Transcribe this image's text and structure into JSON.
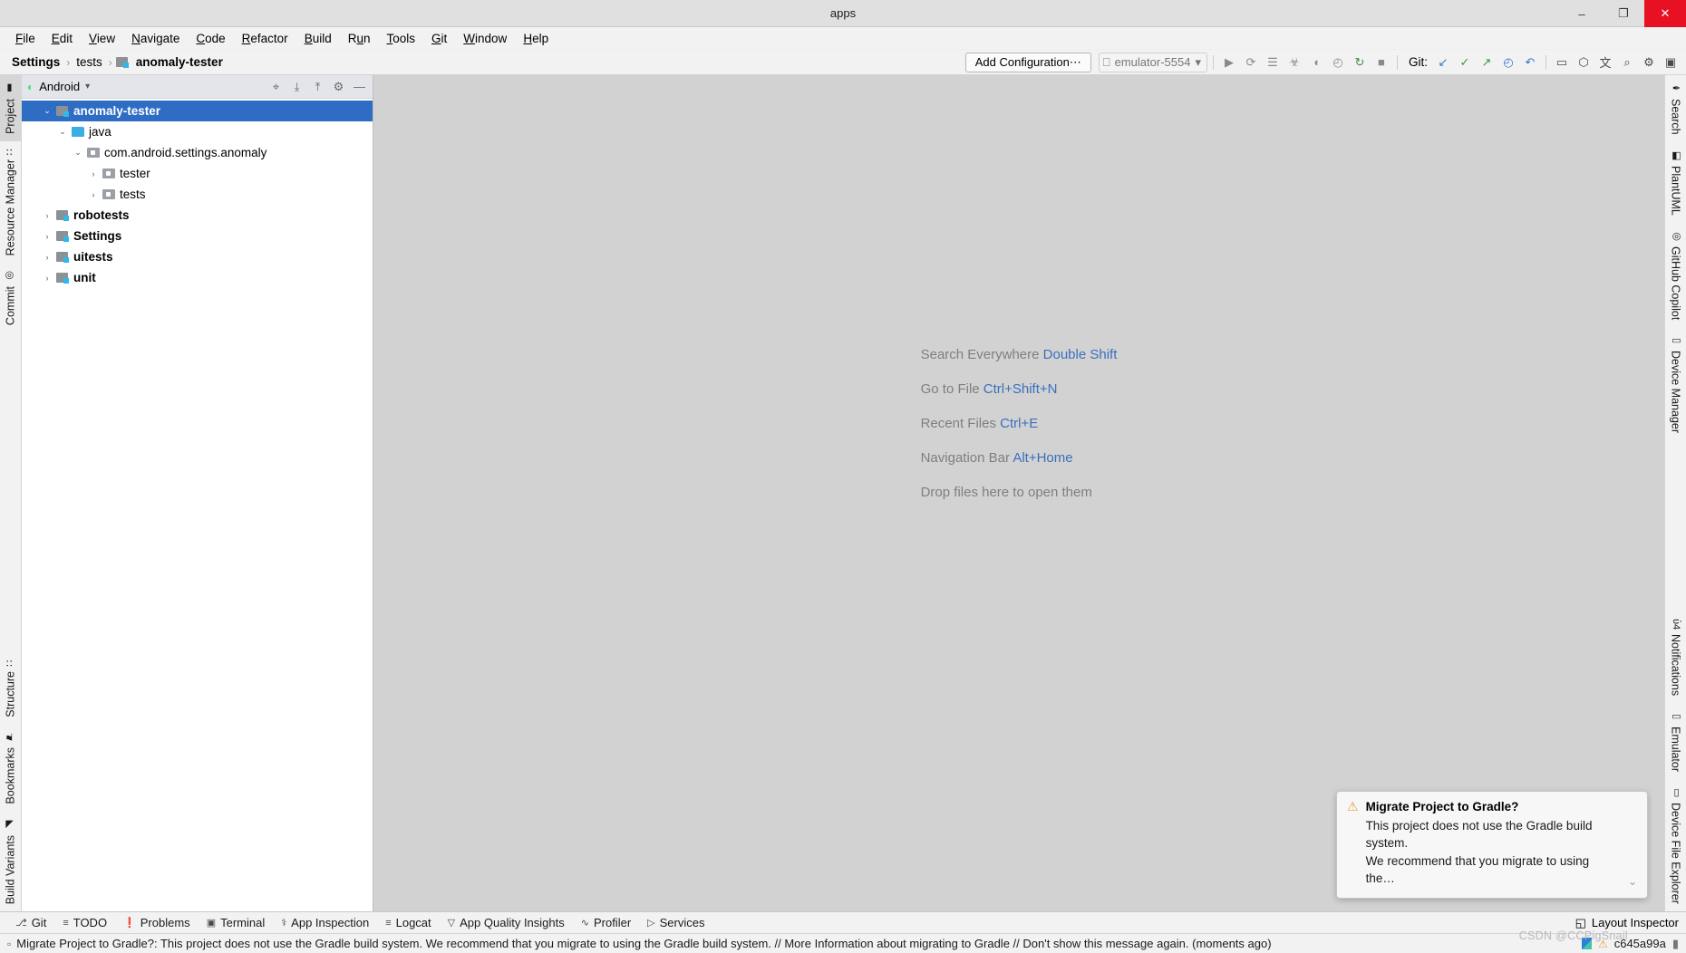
{
  "window": {
    "title": "apps",
    "minimize": "–",
    "maximize": "❐",
    "close": "✕"
  },
  "menubar": {
    "items": [
      {
        "pre": "",
        "mn": "F",
        "post": "ile"
      },
      {
        "pre": "",
        "mn": "E",
        "post": "dit"
      },
      {
        "pre": "",
        "mn": "V",
        "post": "iew"
      },
      {
        "pre": "",
        "mn": "N",
        "post": "avigate"
      },
      {
        "pre": "",
        "mn": "C",
        "post": "ode"
      },
      {
        "pre": "",
        "mn": "R",
        "post": "efactor"
      },
      {
        "pre": "",
        "mn": "B",
        "post": "uild"
      },
      {
        "pre": "R",
        "mn": "u",
        "post": "n"
      },
      {
        "pre": "",
        "mn": "T",
        "post": "ools"
      },
      {
        "pre": "",
        "mn": "G",
        "post": "it"
      },
      {
        "pre": "",
        "mn": "W",
        "post": "indow"
      },
      {
        "pre": "",
        "mn": "H",
        "post": "elp"
      }
    ]
  },
  "breadcrumb": {
    "items": [
      "Settings",
      "tests",
      "anomaly-tester"
    ],
    "separator": "›"
  },
  "toolbar": {
    "add_configuration": "Add Configuration⋯",
    "device": "emulator-5554",
    "device_caret": "▾",
    "git_label": "Git:",
    "icons": [
      {
        "name": "run-icon",
        "glyph": "▶"
      },
      {
        "name": "run-coverage-icon",
        "glyph": "⟳"
      },
      {
        "name": "logcat-icon",
        "glyph": "☰"
      },
      {
        "name": "debug-icon",
        "glyph": "☣"
      },
      {
        "name": "attach-debugger-icon",
        "glyph": "◖"
      },
      {
        "name": "profiler-icon",
        "glyph": "◴"
      },
      {
        "name": "sync-gradle-icon",
        "glyph": "↻"
      },
      {
        "name": "stop-icon",
        "glyph": "■"
      }
    ],
    "git_icons": [
      {
        "name": "update-project-icon",
        "glyph": "↙"
      },
      {
        "name": "commit-icon",
        "glyph": "✓"
      },
      {
        "name": "push-icon",
        "glyph": "↗"
      },
      {
        "name": "history-icon",
        "glyph": "◴"
      },
      {
        "name": "rollback-icon",
        "glyph": "↶"
      }
    ],
    "right_icons": [
      {
        "name": "avd-manager-icon",
        "glyph": "▭"
      },
      {
        "name": "sdk-manager-icon",
        "glyph": "⬡"
      },
      {
        "name": "translate-icon",
        "glyph": "文"
      },
      {
        "name": "search-icon",
        "glyph": "⌕"
      },
      {
        "name": "settings-gear-icon",
        "glyph": "⚙"
      },
      {
        "name": "account-icon",
        "glyph": "▣"
      }
    ]
  },
  "left_sidebar": {
    "top": [
      {
        "label": "Project",
        "icon": "project-folder-icon",
        "glyph": "▮",
        "active": true
      },
      {
        "label": "Resource Manager",
        "icon": "resource-manager-icon",
        "glyph": "∷",
        "active": false
      },
      {
        "label": "Commit",
        "icon": "commit-icon",
        "glyph": "◎",
        "active": false
      }
    ],
    "bottom": [
      {
        "label": "Structure",
        "icon": "structure-icon",
        "glyph": "∷",
        "active": false
      },
      {
        "label": "Bookmarks",
        "icon": "bookmark-icon",
        "glyph": "⚑",
        "active": false
      },
      {
        "label": "Build Variants",
        "icon": "build-variants-icon",
        "glyph": "◢",
        "active": false
      }
    ]
  },
  "right_sidebar": {
    "top": [
      {
        "label": "Search",
        "icon": "search-feather-icon",
        "glyph": "✒"
      },
      {
        "label": "PlantUML",
        "icon": "plantuml-icon",
        "glyph": "◧"
      },
      {
        "label": "GitHub Copilot",
        "icon": "github-copilot-icon",
        "glyph": "◎"
      },
      {
        "label": "Device Manager",
        "icon": "device-manager-icon",
        "glyph": "▭"
      }
    ],
    "bottom": [
      {
        "label": "Notifications",
        "icon": "notifications-bell-icon",
        "glyph": "ὑ4"
      },
      {
        "label": "Emulator",
        "icon": "emulator-icon",
        "glyph": "▭"
      },
      {
        "label": "Device File Explorer",
        "icon": "device-file-explorer-icon",
        "glyph": "▯"
      }
    ]
  },
  "project_panel": {
    "header": {
      "title": "Android",
      "android_icon": "android-robot-icon",
      "caret": "▾",
      "actions": [
        {
          "name": "select-opened-file-icon",
          "glyph": "⌖"
        },
        {
          "name": "expand-all-icon",
          "glyph": "⤓"
        },
        {
          "name": "collapse-all-icon",
          "glyph": "⤒"
        },
        {
          "name": "settings-gear-icon",
          "glyph": "⚙"
        },
        {
          "name": "hide-icon",
          "glyph": "—"
        }
      ]
    },
    "tree": [
      {
        "label": "anomaly-tester",
        "indent": 0,
        "arrow": "⌄",
        "icon": "module",
        "bold": true,
        "selected": true
      },
      {
        "label": "java",
        "indent": 1,
        "arrow": "⌄",
        "icon": "folder",
        "bold": false,
        "selected": false
      },
      {
        "label": "com.android.settings.anomaly",
        "indent": 2,
        "arrow": "⌄",
        "icon": "package",
        "bold": false,
        "selected": false
      },
      {
        "label": "tester",
        "indent": 3,
        "arrow": "›",
        "icon": "package",
        "bold": false,
        "selected": false
      },
      {
        "label": "tests",
        "indent": 3,
        "arrow": "›",
        "icon": "package",
        "bold": false,
        "selected": false
      },
      {
        "label": "robotests",
        "indent": 0,
        "arrow": "›",
        "icon": "module",
        "bold": true,
        "selected": false
      },
      {
        "label": "Settings",
        "indent": 0,
        "arrow": "›",
        "icon": "module",
        "bold": true,
        "selected": false
      },
      {
        "label": "uitests",
        "indent": 0,
        "arrow": "›",
        "icon": "module",
        "bold": true,
        "selected": false
      },
      {
        "label": "unit",
        "indent": 0,
        "arrow": "›",
        "icon": "module",
        "bold": true,
        "selected": false
      }
    ]
  },
  "editor": {
    "hints": [
      {
        "text": "Search Everywhere",
        "key": "Double Shift"
      },
      {
        "text": "Go to File",
        "key": "Ctrl+Shift+N"
      },
      {
        "text": "Recent Files",
        "key": "Ctrl+E"
      },
      {
        "text": "Navigation Bar",
        "key": "Alt+Home"
      },
      {
        "text": "Drop files here to open them",
        "key": ""
      }
    ]
  },
  "notification": {
    "warning_icon": "warning-triangle-icon",
    "title": "Migrate Project to Gradle?",
    "line1": "This project does not use the Gradle build system.",
    "line2": "We recommend that you migrate to using the…",
    "expand_caret": "⌄"
  },
  "bottom_bar": {
    "tabs": [
      {
        "label": "Git",
        "icon": "git-branch-icon",
        "glyph": "⎇"
      },
      {
        "label": "TODO",
        "icon": "todo-list-icon",
        "glyph": "≡"
      },
      {
        "label": "Problems",
        "icon": "problems-icon",
        "glyph": "❗"
      },
      {
        "label": "Terminal",
        "icon": "terminal-icon",
        "glyph": "▣"
      },
      {
        "label": "App Inspection",
        "icon": "app-inspection-icon",
        "glyph": "⚕"
      },
      {
        "label": "Logcat",
        "icon": "logcat-icon",
        "glyph": "≡"
      },
      {
        "label": "App Quality Insights",
        "icon": "app-quality-insights-icon",
        "glyph": "▽"
      },
      {
        "label": "Profiler",
        "icon": "profiler-icon",
        "glyph": "∿"
      },
      {
        "label": "Services",
        "icon": "services-icon",
        "glyph": "▷"
      }
    ],
    "right": {
      "label": "Layout Inspector",
      "icon": "layout-inspector-icon",
      "glyph": "◱"
    }
  },
  "status_bar": {
    "icon": "event-log-icon",
    "glyph": "▫",
    "message": "Migrate Project to Gradle?: This project does not use the Gradle build system. We recommend that you migrate to using the Gradle build system. // More Information about migrating to Gradle // Don't show this message again. (moments ago)",
    "watermark": "CSDN @CCPigSnail",
    "right": {
      "branch_icon": "branch-flag-icon",
      "warning_icon": "warning-triangle-icon",
      "commit_hash": "c645a99a",
      "memory_icon": "memory-indicator-icon",
      "memory_glyph": "▮"
    }
  }
}
